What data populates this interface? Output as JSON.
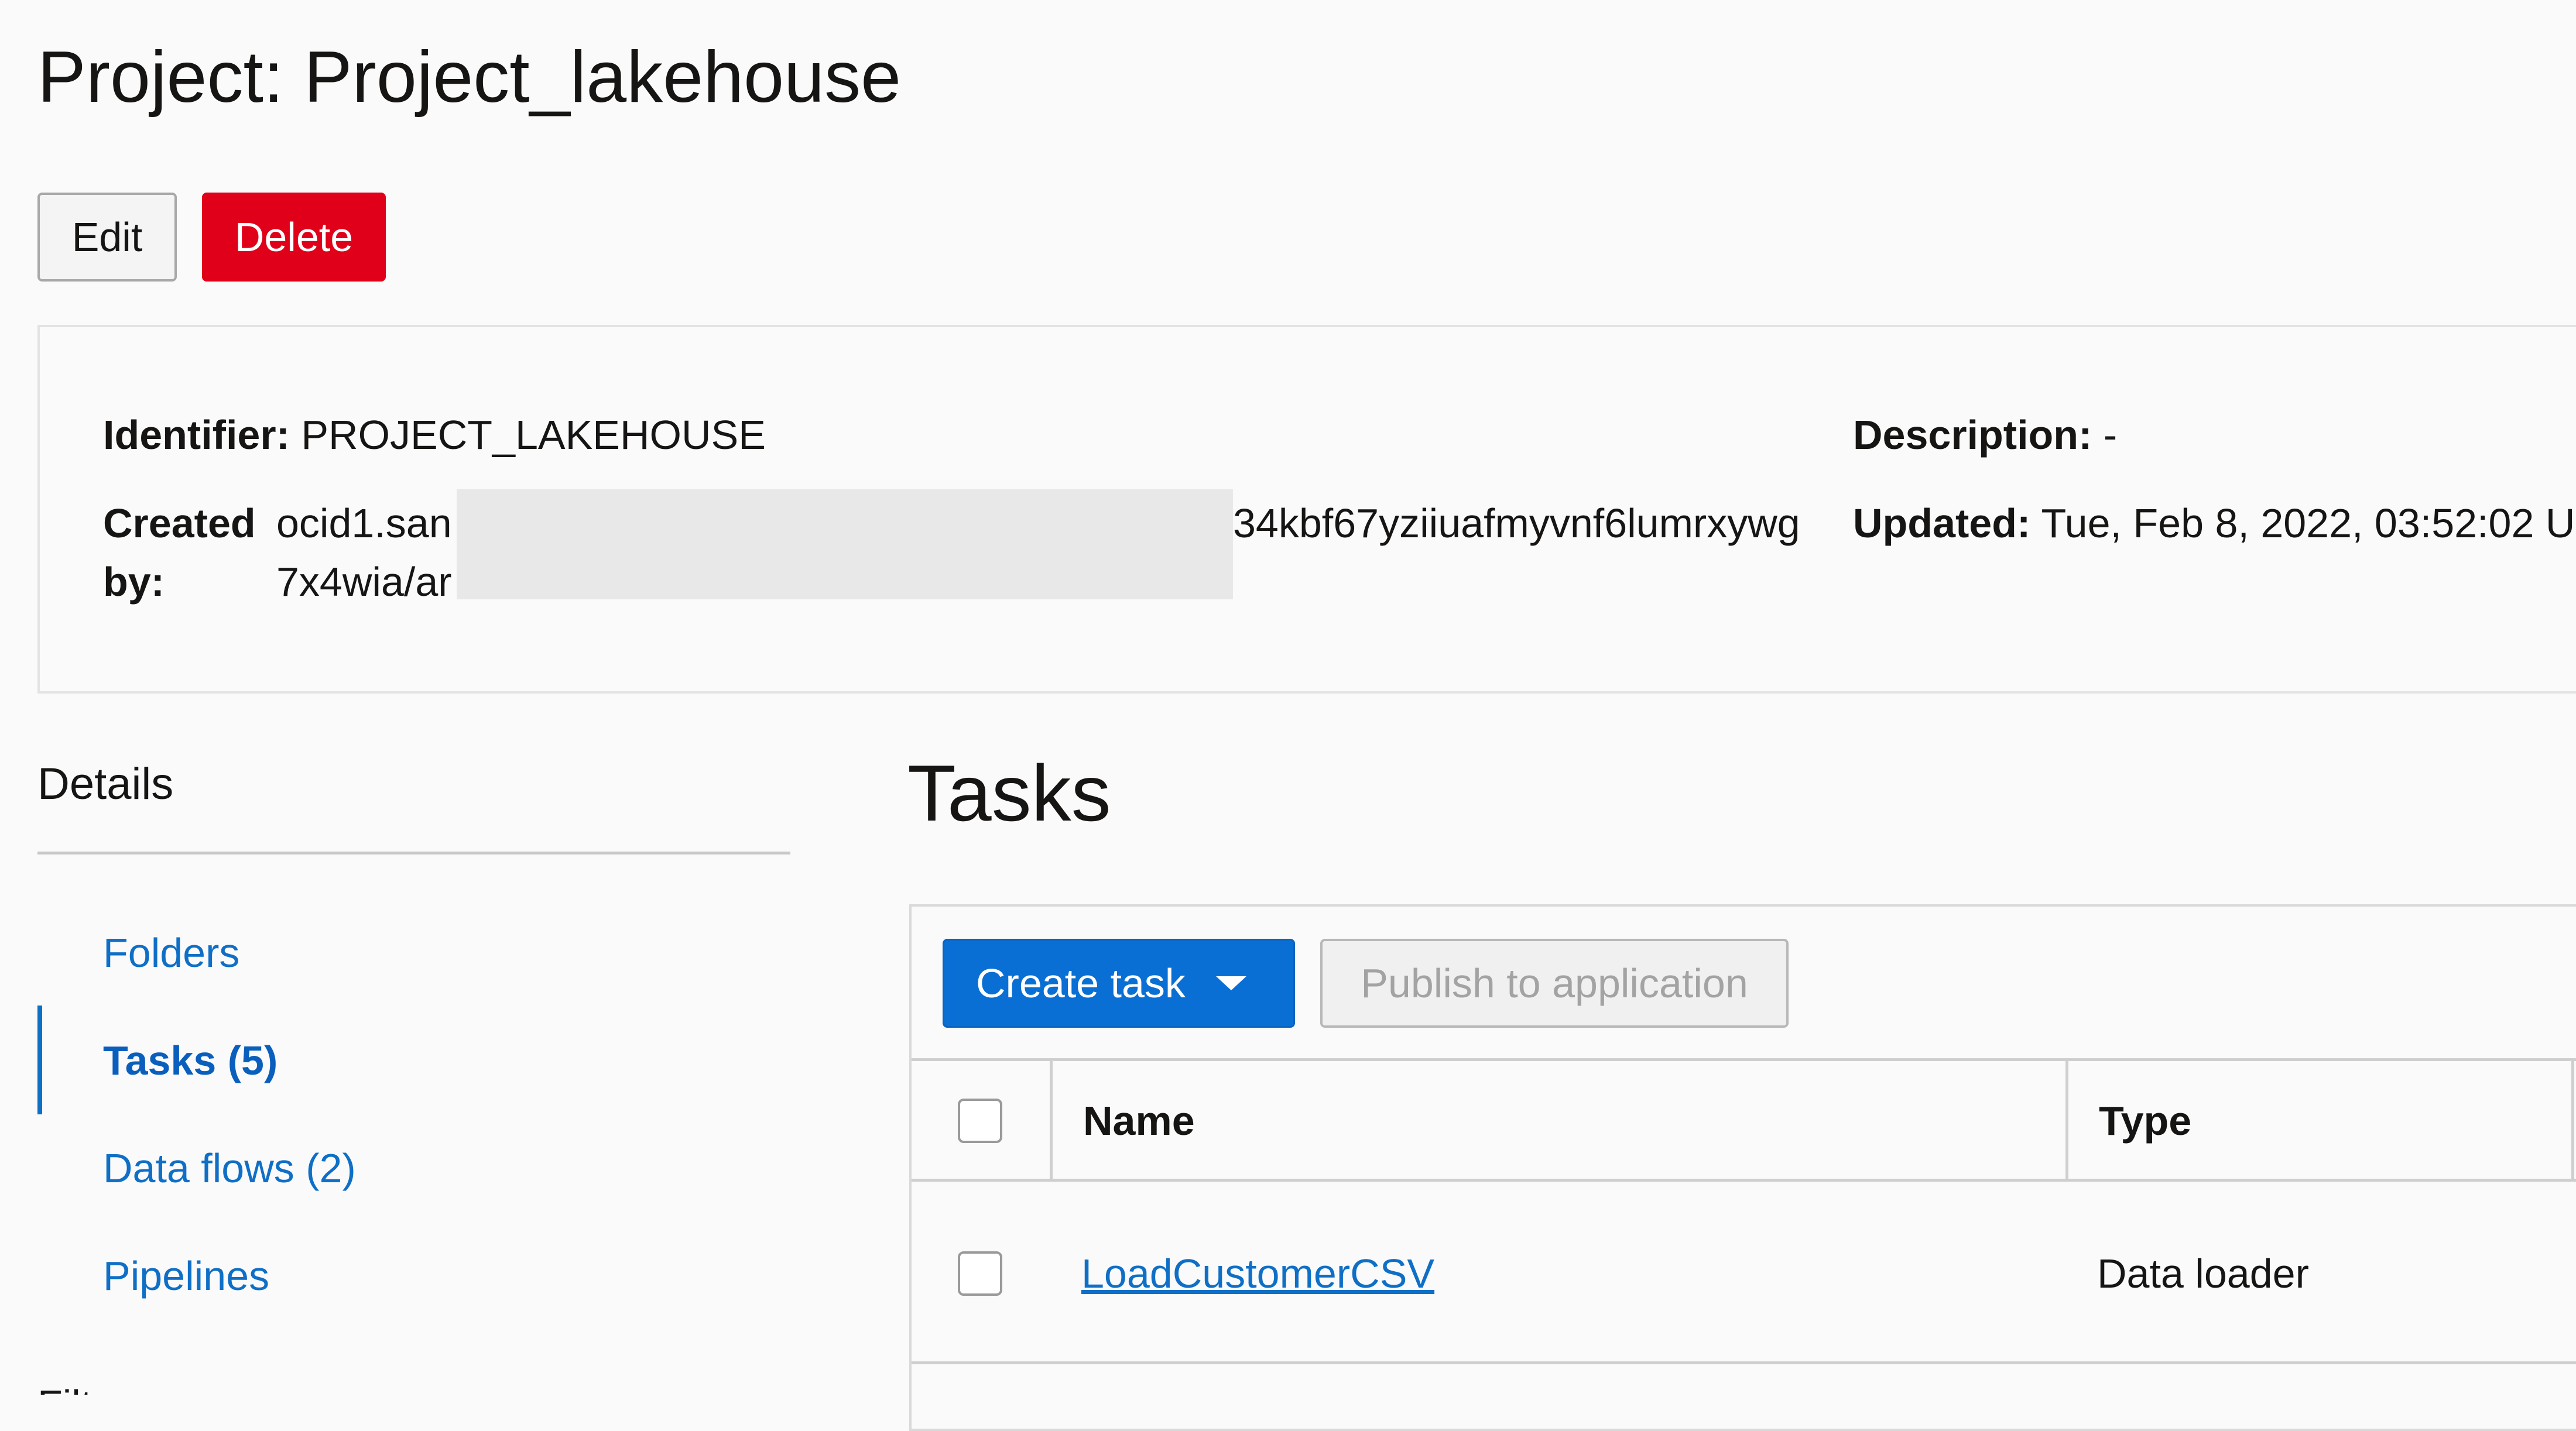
{
  "page": {
    "title": "Project: Project_lakehouse"
  },
  "actions": {
    "edit_label": "Edit",
    "delete_label": "Delete"
  },
  "info": {
    "identifier_label": "Identifier:",
    "identifier_value": "PROJECT_LAKEHOUSE",
    "created_by_label_line1": "Created",
    "created_by_label_line2": "by:",
    "created_by_value_line1_start": "ocid1.san",
    "created_by_value_line1_end": "34kbf67yziiuafmyvnf6lumrxywg",
    "created_by_value_line2_start": "7x4wia/ar",
    "description_label": "Description:",
    "description_value": "-",
    "updated_label": "Updated:",
    "updated_value": "Tue, Feb 8, 2022, 03:52:02 U"
  },
  "sidebar": {
    "heading": "Details",
    "items": [
      {
        "label": "Folders",
        "active": false
      },
      {
        "label": "Tasks (5)",
        "active": true
      },
      {
        "label": "Data flows (2)",
        "active": false
      },
      {
        "label": "Pipelines",
        "active": false
      }
    ],
    "next_item_cutoff": "Filt"
  },
  "tasks": {
    "title": "Tasks",
    "create_label": "Create task",
    "publish_label": "Publish to application",
    "columns": [
      "Name",
      "Type"
    ],
    "rows": [
      {
        "name": "LoadCustomerCSV",
        "type": "Data loader"
      }
    ]
  },
  "colors": {
    "accent": "#0a6fd4",
    "danger": "#e0001a",
    "link": "#0f6fc6"
  }
}
